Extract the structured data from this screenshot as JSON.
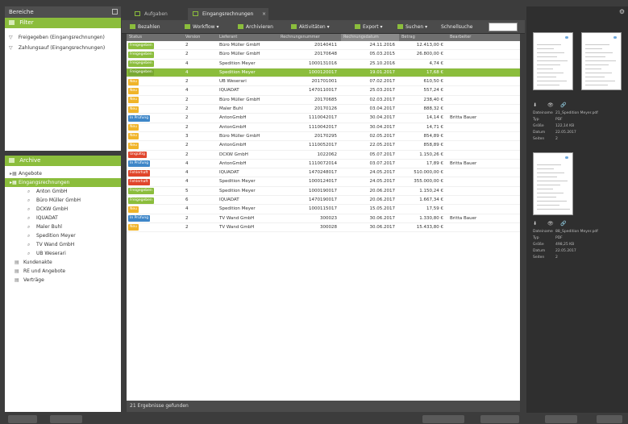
{
  "left": {
    "header_title": "Bereiche",
    "filter_title": "Filter",
    "filters": [
      "Freigegeben (Eingangsrechnungen)",
      "Zahlungsauf (Eingangsrechnungen)"
    ],
    "archive_title": "Archive",
    "tree": [
      {
        "label": "Angebote",
        "level": 1,
        "icon": "folder-icon"
      },
      {
        "label": "Eingangsrechnungen",
        "level": 1,
        "icon": "folder-icon",
        "selected": true
      },
      {
        "label": "Anton GmbH",
        "level": 3,
        "icon": "search-icon"
      },
      {
        "label": "Büro Müller GmbH",
        "level": 3,
        "icon": "search-icon"
      },
      {
        "label": "DCKW GmbH",
        "level": 3,
        "icon": "search-icon"
      },
      {
        "label": "IQUADAT",
        "level": 3,
        "icon": "search-icon"
      },
      {
        "label": "Maler Buhl",
        "level": 3,
        "icon": "search-icon"
      },
      {
        "label": "Spedition Meyer",
        "level": 3,
        "icon": "search-icon"
      },
      {
        "label": "TV Wand GmbH",
        "level": 3,
        "icon": "search-icon"
      },
      {
        "label": "UB Weserari",
        "level": 3,
        "icon": "search-icon"
      },
      {
        "label": "Kundenakte",
        "level": 2,
        "icon": "archive-icon"
      },
      {
        "label": "RE und Angebote",
        "level": 2,
        "icon": "archive-icon"
      },
      {
        "label": "Verträge",
        "level": 2,
        "icon": "archive-icon"
      }
    ]
  },
  "tabs": [
    {
      "label": "Aufgaben",
      "icon": "task-icon"
    },
    {
      "label": "Eingangsrechnungen",
      "icon": "document-icon",
      "active": true
    }
  ],
  "toolbar": [
    {
      "label": "Bezahlen",
      "icon": "pay-icon"
    },
    {
      "label": "Workflow",
      "icon": "workflow-icon"
    },
    {
      "label": "Archivieren",
      "icon": "archive-icon"
    },
    {
      "label": "Aktivitäten",
      "icon": "activity-icon"
    },
    {
      "label": "Export",
      "icon": "export-icon"
    },
    {
      "label": "Suchen",
      "icon": "search-icon"
    }
  ],
  "search_label": "Schnellsuche",
  "columns": [
    "Status",
    "Version",
    "Lieferant",
    "Rechnungsnummer",
    "Rechnungsdatum",
    "Betrag",
    "Bearbeiter"
  ],
  "rows": [
    {
      "status": "Freigegeben",
      "color": "#8bbd3c",
      "version": "2",
      "vendor": "Büro Müller GmbH",
      "number": "20140411",
      "date": "24.11.2016",
      "amount": "12.413,00 €",
      "agent": ""
    },
    {
      "status": "Freigegeben",
      "color": "#8bbd3c",
      "version": "2",
      "vendor": "Büro Müller GmbH",
      "number": "20170648",
      "date": "05.03.2015",
      "amount": "26.800,00 €",
      "agent": ""
    },
    {
      "status": "Freigegeben",
      "color": "#8bbd3c",
      "version": "4",
      "vendor": "Spedition Meyer",
      "number": "1000131016",
      "date": "25.10.2016",
      "amount": "4,74 €",
      "agent": ""
    },
    {
      "status": "Freigegeben",
      "color": "#79a832",
      "version": "4",
      "vendor": "Spedition Meyer",
      "number": "1000120017",
      "date": "19.01.2017",
      "amount": "17,68 €",
      "agent": "",
      "selected": true
    },
    {
      "status": "Neu",
      "color": "#f0b429",
      "version": "2",
      "vendor": "UB Weserari",
      "number": "201701001",
      "date": "07.02.2017",
      "amount": "610,50 €",
      "agent": ""
    },
    {
      "status": "Neu",
      "color": "#f0b429",
      "version": "4",
      "vendor": "IQUADAT",
      "number": "1470110017",
      "date": "25.03.2017",
      "amount": "557,24 €",
      "agent": ""
    },
    {
      "status": "Neu",
      "color": "#f0b429",
      "version": "2",
      "vendor": "Büro Müller GmbH",
      "number": "20170685",
      "date": "02.03.2017",
      "amount": "238,40 €",
      "agent": ""
    },
    {
      "status": "Neu",
      "color": "#f0b429",
      "version": "2",
      "vendor": "Maler Buhl",
      "number": "20170126",
      "date": "03.04.2017",
      "amount": "888,32 €",
      "agent": ""
    },
    {
      "status": "In Prüfung",
      "color": "#3e86c8",
      "version": "2",
      "vendor": "AntonGmbH",
      "number": "1110042017",
      "date": "30.04.2017",
      "amount": "14,14 €",
      "agent": "Britta Bauer"
    },
    {
      "status": "Neu",
      "color": "#f0b429",
      "version": "2",
      "vendor": "AntonGmbH",
      "number": "1110042017",
      "date": "30.04.2017",
      "amount": "14,71 €",
      "agent": ""
    },
    {
      "status": "Neu",
      "color": "#f0b429",
      "version": "3",
      "vendor": "Büro Müller GmbH",
      "number": "20170295",
      "date": "02.05.2017",
      "amount": "854,89 €",
      "agent": ""
    },
    {
      "status": "Neu",
      "color": "#f0b429",
      "version": "2",
      "vendor": "AntonGmbH",
      "number": "1110052017",
      "date": "22.05.2017",
      "amount": "858,89 €",
      "agent": ""
    },
    {
      "status": "Ungültig",
      "color": "#e0452b",
      "version": "2",
      "vendor": "DCKW GmbH",
      "number": "1022062",
      "date": "05.07.2017",
      "amount": "1.150,26 €",
      "agent": ""
    },
    {
      "status": "In Prüfung",
      "color": "#3e86c8",
      "version": "4",
      "vendor": "AntonGmbH",
      "number": "1110072014",
      "date": "03.07.2017",
      "amount": "17,89 €",
      "agent": "Britta Bauer"
    },
    {
      "status": "Fehlerhaft",
      "color": "#e0452b",
      "version": "4",
      "vendor": "IQUADAT",
      "number": "1470248017",
      "date": "24.05.2017",
      "amount": "510.000,00 €",
      "agent": ""
    },
    {
      "status": "Fehlerhaft",
      "color": "#e0452b",
      "version": "4",
      "vendor": "Spedition Meyer",
      "number": "1000124017",
      "date": "24.05.2017",
      "amount": "355.000,00 €",
      "agent": ""
    },
    {
      "status": "Freigegeben",
      "color": "#8bbd3c",
      "version": "5",
      "vendor": "Spedition Meyer",
      "number": "1000190017",
      "date": "20.06.2017",
      "amount": "1.150,24 €",
      "agent": ""
    },
    {
      "status": "Freigegeben",
      "color": "#8bbd3c",
      "version": "6",
      "vendor": "IQUADAT",
      "number": "1470190017",
      "date": "20.06.2017",
      "amount": "1.667,34 €",
      "agent": ""
    },
    {
      "status": "Neu",
      "color": "#f0b429",
      "version": "4",
      "vendor": "Spedition Meyer",
      "number": "1000115017",
      "date": "15.05.2017",
      "amount": "17,59 €",
      "agent": ""
    },
    {
      "status": "In Prüfung",
      "color": "#3e86c8",
      "version": "2",
      "vendor": "TV Wand GmbH",
      "number": "300023",
      "date": "30.06.2017",
      "amount": "1.330,80 €",
      "agent": "Britta Bauer"
    },
    {
      "status": "Neu",
      "color": "#f0b429",
      "version": "2",
      "vendor": "TV Wand GmbH",
      "number": "300028",
      "date": "30.06.2017",
      "amount": "15.433,80 €",
      "agent": ""
    }
  ],
  "status_text": "21 Ergebnisse gefunden",
  "preview": {
    "doc1": [
      {
        "k": "Dateiname",
        "v": "21_Spedition Meyer.pdf"
      },
      {
        "k": "Typ",
        "v": "PDF"
      },
      {
        "k": "Größe",
        "v": "122,14 KB"
      },
      {
        "k": "Datum",
        "v": "22.05.2017"
      },
      {
        "k": "Seiten",
        "v": "2"
      }
    ],
    "doc2": [
      {
        "k": "Dateiname",
        "v": "88_Spedition Meyer.pdf"
      },
      {
        "k": "Typ",
        "v": "PDF"
      },
      {
        "k": "Größe",
        "v": "498,25 KB"
      },
      {
        "k": "Datum",
        "v": "22.05.2017"
      },
      {
        "k": "Seiten",
        "v": "2"
      }
    ]
  }
}
